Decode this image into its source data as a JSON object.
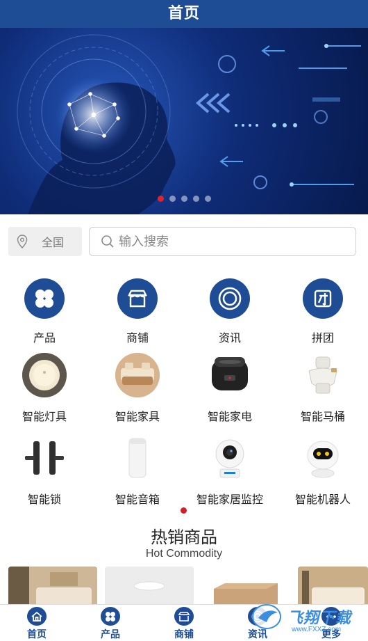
{
  "header": {
    "title": "首页"
  },
  "banner": {
    "slide_count": 5,
    "active_index": 0
  },
  "location": {
    "label": "全国"
  },
  "search": {
    "placeholder": "输入搜索"
  },
  "quick_nav": [
    {
      "label": "产品",
      "icon": "clover-icon"
    },
    {
      "label": "商铺",
      "icon": "store-icon"
    },
    {
      "label": "资讯",
      "icon": "target-icon"
    },
    {
      "label": "拼团",
      "icon": "group-icon"
    }
  ],
  "categories_row1": [
    {
      "label": "智能灯具"
    },
    {
      "label": "智能家具"
    },
    {
      "label": "智能家电"
    },
    {
      "label": "智能马桶"
    }
  ],
  "categories_row2": [
    {
      "label": "智能锁"
    },
    {
      "label": "智能音箱"
    },
    {
      "label": "智能家居监控"
    },
    {
      "label": "智能机器人"
    }
  ],
  "hot_section": {
    "title": "热销商品",
    "subtitle": "Hot Commodity"
  },
  "tabbar": [
    {
      "label": "首页",
      "icon": "home-icon"
    },
    {
      "label": "产品",
      "icon": "clover-icon"
    },
    {
      "label": "商铺",
      "icon": "store-icon"
    },
    {
      "label": "资讯",
      "icon": "target-icon"
    },
    {
      "label": "更多",
      "icon": "more-icon"
    }
  ],
  "watermark": {
    "text": "飞翔下载",
    "url_text": "www.FXXZ.com"
  },
  "colors": {
    "brand": "#1f4d95",
    "accent": "#e0232a"
  }
}
